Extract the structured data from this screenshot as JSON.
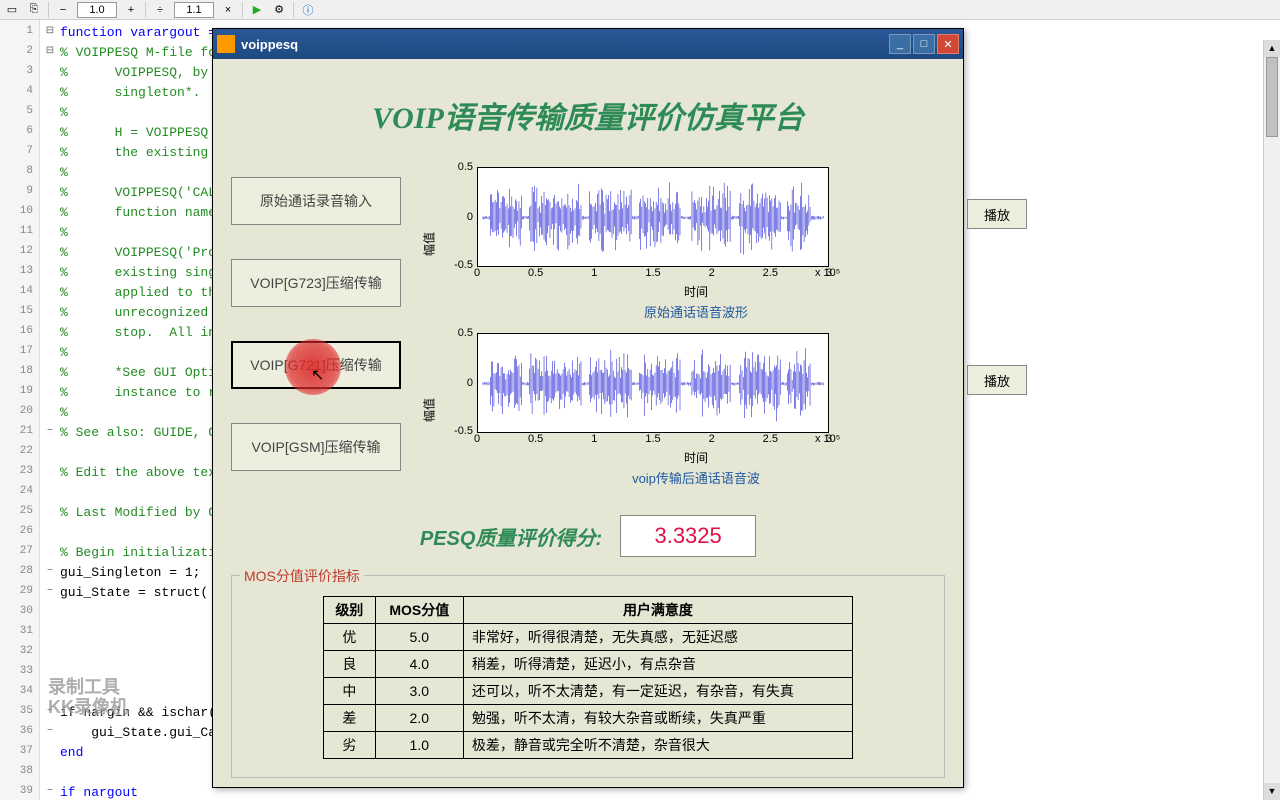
{
  "toolbar": {
    "zoom1": "1.0",
    "zoom2": "1.1"
  },
  "editor": {
    "lines": [
      {
        "n": 1,
        "f": "⊟",
        "text": "function varargout =",
        "cls": "kw"
      },
      {
        "n": 2,
        "f": "⊟",
        "text": "% VOIPPESQ M-file fo",
        "cls": "cm"
      },
      {
        "n": 3,
        "f": "",
        "text": "%      VOIPPESQ, by ",
        "cls": "cm"
      },
      {
        "n": 4,
        "f": "",
        "text": "%      singleton*.",
        "cls": "cm"
      },
      {
        "n": 5,
        "f": "",
        "text": "%",
        "cls": "cm"
      },
      {
        "n": 6,
        "f": "",
        "text": "%      H = VOIPPESQ ",
        "cls": "cm"
      },
      {
        "n": 7,
        "f": "",
        "text": "%      the existing ",
        "cls": "cm"
      },
      {
        "n": 8,
        "f": "",
        "text": "%",
        "cls": "cm"
      },
      {
        "n": 9,
        "f": "",
        "text": "%      VOIPPESQ('CAL",
        "cls": "cm"
      },
      {
        "n": 10,
        "f": "",
        "text": "%      function name",
        "cls": "cm"
      },
      {
        "n": 11,
        "f": "",
        "text": "%",
        "cls": "cm"
      },
      {
        "n": 12,
        "f": "",
        "text": "%      VOIPPESQ('Pro",
        "cls": "cm"
      },
      {
        "n": 13,
        "f": "",
        "text": "%      existing sing",
        "cls": "cm"
      },
      {
        "n": 14,
        "f": "",
        "text": "%      applied to th",
        "cls": "cm"
      },
      {
        "n": 15,
        "f": "",
        "text": "%      unrecognized ",
        "cls": "cm"
      },
      {
        "n": 16,
        "f": "",
        "text": "%      stop.  All in",
        "cls": "cm"
      },
      {
        "n": 17,
        "f": "",
        "text": "%",
        "cls": "cm"
      },
      {
        "n": 18,
        "f": "",
        "text": "%      *See GUI Opti",
        "cls": "cm"
      },
      {
        "n": 19,
        "f": "",
        "text": "%      instance to r",
        "cls": "cm"
      },
      {
        "n": 20,
        "f": "",
        "text": "%",
        "cls": "cm"
      },
      {
        "n": 21,
        "f": "−",
        "text": "% See also: GUIDE, G",
        "cls": "cm"
      },
      {
        "n": 22,
        "f": "",
        "text": "",
        "cls": ""
      },
      {
        "n": 23,
        "f": "",
        "text": "% Edit the above tex",
        "cls": "cm"
      },
      {
        "n": 24,
        "f": "",
        "text": "",
        "cls": ""
      },
      {
        "n": 25,
        "f": "",
        "text": "% Last Modified by G",
        "cls": "cm"
      },
      {
        "n": 26,
        "f": "",
        "text": "",
        "cls": ""
      },
      {
        "n": 27,
        "f": "",
        "text": "% Begin initializati",
        "cls": "cm"
      },
      {
        "n": 28,
        "f": "−",
        "text": "gui_Singleton = 1;",
        "cls": ""
      },
      {
        "n": 29,
        "f": "−",
        "text": "gui_State = struct(",
        "cls": ""
      },
      {
        "n": 30,
        "f": "",
        "text": "                    ",
        "cls": ""
      },
      {
        "n": 31,
        "f": "",
        "text": "                    ",
        "cls": ""
      },
      {
        "n": 32,
        "f": "",
        "text": "                    ",
        "cls": ""
      },
      {
        "n": 33,
        "f": "",
        "text": "                    ",
        "cls": ""
      },
      {
        "n": 34,
        "f": "",
        "text": "                    ",
        "cls": ""
      },
      {
        "n": 35,
        "f": "−",
        "text": "if nargin && ischar(",
        "cls": ""
      },
      {
        "n": 36,
        "f": "−",
        "text": "    gui_State.gui_Ca",
        "cls": ""
      },
      {
        "n": 37,
        "f": "",
        "text": "end",
        "cls": "kw"
      },
      {
        "n": 38,
        "f": "",
        "text": "",
        "cls": ""
      },
      {
        "n": 39,
        "f": "−",
        "text": "if nargout",
        "cls": "kw"
      }
    ]
  },
  "dialog": {
    "title": "voippesq",
    "mainTitle": "VOIP语音传输质量评价仿真平台",
    "buttons": {
      "input": "原始通话录音输入",
      "g723": "VOIP[G723]压缩传输",
      "g721": "VOIP[G721]压缩传输",
      "gsm": "VOIP[GSM]压缩传输"
    },
    "play": "播放",
    "chart1": {
      "ylabel": "幅值",
      "xlabel": "时间",
      "title": "原始通话语音波形",
      "exp": "x 10⁵"
    },
    "chart2": {
      "ylabel": "幅值",
      "xlabel": "时间",
      "title": "voip传输后通话语音波",
      "exp": "x 10⁵"
    },
    "yticks": [
      "0.5",
      "0",
      "-0.5"
    ],
    "xticks": [
      "0",
      "0.5",
      "1",
      "1.5",
      "2",
      "2.5",
      "3"
    ],
    "pesq": {
      "label": "PESQ质量评价得分:",
      "value": "3.3325"
    },
    "mos": {
      "legend": "MOS分值评价指标",
      "headers": [
        "级别",
        "MOS分值",
        "用户满意度"
      ],
      "rows": [
        [
          "优",
          "5.0",
          "非常好，听得很清楚，无失真感，无延迟感"
        ],
        [
          "良",
          "4.0",
          "稍差，听得清楚，延迟小，有点杂音"
        ],
        [
          "中",
          "3.0",
          "还可以，听不太清楚，有一定延迟，有杂音，有失真"
        ],
        [
          "差",
          "2.0",
          "勉强，听不太清，有较大杂音或断续，失真严重"
        ],
        [
          "劣",
          "1.0",
          "极差，静音或完全听不清楚，杂音很大"
        ]
      ]
    }
  },
  "watermark": {
    "l1": "录制工具",
    "l2": "KK录像机"
  },
  "chart_data": [
    {
      "type": "line",
      "title": "原始通话语音波形",
      "xlabel": "时间",
      "ylabel": "幅值",
      "xlim": [
        0,
        300000.0
      ],
      "ylim": [
        -0.5,
        0.5
      ],
      "note": "dense audio waveform"
    },
    {
      "type": "line",
      "title": "voip传输后通话语音波",
      "xlabel": "时间",
      "ylabel": "幅值",
      "xlim": [
        0,
        300000.0
      ],
      "ylim": [
        -0.5,
        0.5
      ],
      "note": "dense audio waveform"
    }
  ]
}
